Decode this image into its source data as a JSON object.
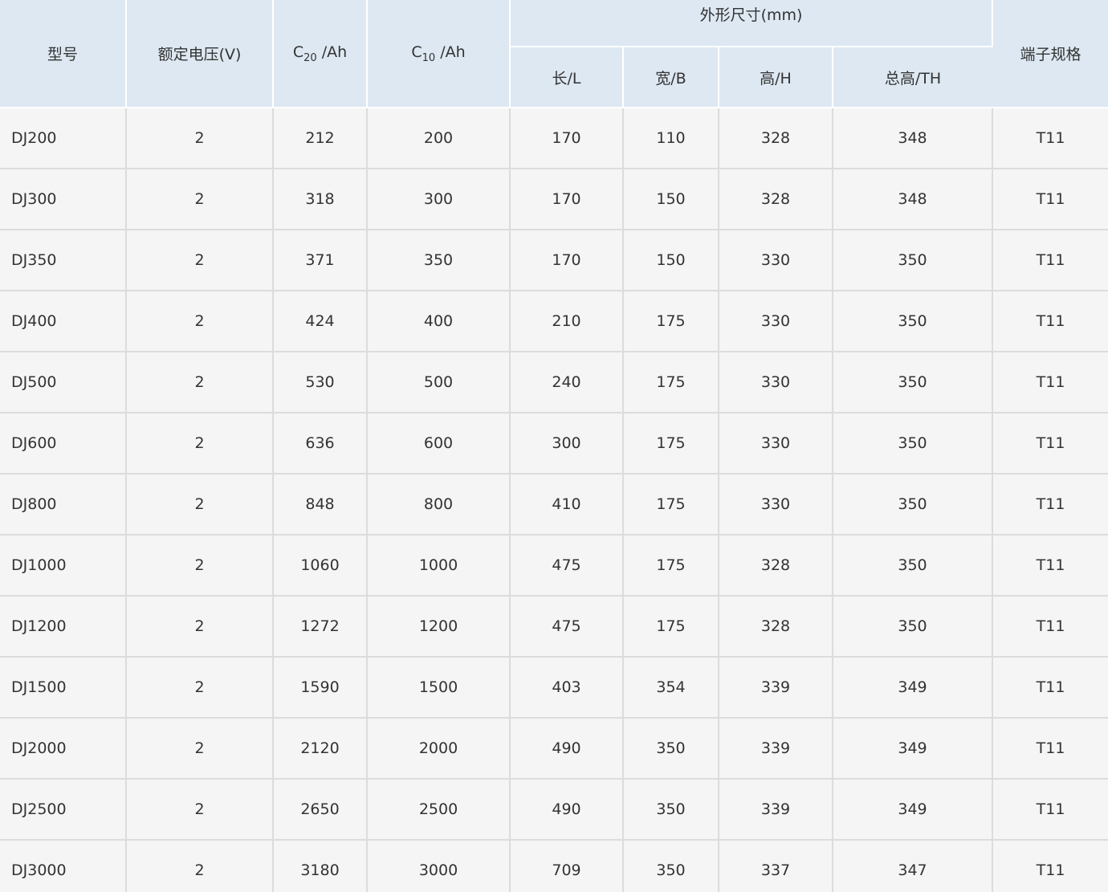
{
  "header": {
    "model": "型号",
    "voltage": "额定电压(V)",
    "c20_main": "C",
    "c20_sub": "20",
    "c20_unit": " /Ah",
    "c10_main": "C",
    "c10_sub": "10",
    "c10_unit": " /Ah",
    "dimensions": "外形尺寸(mm)",
    "length": "长/L",
    "width": "宽/B",
    "height": "高/H",
    "total_height": "总高/TH",
    "terminal": "端子规格"
  },
  "rows": [
    [
      "DJ200",
      "2",
      "212",
      "200",
      "170",
      "110",
      "328",
      "348",
      "T11"
    ],
    [
      "DJ300",
      "2",
      "318",
      "300",
      "170",
      "150",
      "328",
      "348",
      "T11"
    ],
    [
      "DJ350",
      "2",
      "371",
      "350",
      "170",
      "150",
      "330",
      "350",
      "T11"
    ],
    [
      "DJ400",
      "2",
      "424",
      "400",
      "210",
      "175",
      "330",
      "350",
      "T11"
    ],
    [
      "DJ500",
      "2",
      "530",
      "500",
      "240",
      "175",
      "330",
      "350",
      "T11"
    ],
    [
      "DJ600",
      "2",
      "636",
      "600",
      "300",
      "175",
      "330",
      "350",
      "T11"
    ],
    [
      "DJ800",
      "2",
      "848",
      "800",
      "410",
      "175",
      "330",
      "350",
      "T11"
    ],
    [
      "DJ1000",
      "2",
      "1060",
      "1000",
      "475",
      "175",
      "328",
      "350",
      "T11"
    ],
    [
      "DJ1200",
      "2",
      "1272",
      "1200",
      "475",
      "175",
      "328",
      "350",
      "T11"
    ],
    [
      "DJ1500",
      "2",
      "1590",
      "1500",
      "403",
      "354",
      "339",
      "349",
      "T11"
    ],
    [
      "DJ2000",
      "2",
      "2120",
      "2000",
      "490",
      "350",
      "339",
      "349",
      "T11"
    ],
    [
      "DJ2500",
      "2",
      "2650",
      "2500",
      "490",
      "350",
      "339",
      "349",
      "T11"
    ],
    [
      "DJ3000",
      "2",
      "3180",
      "3000",
      "709",
      "350",
      "337",
      "347",
      "T11"
    ]
  ]
}
